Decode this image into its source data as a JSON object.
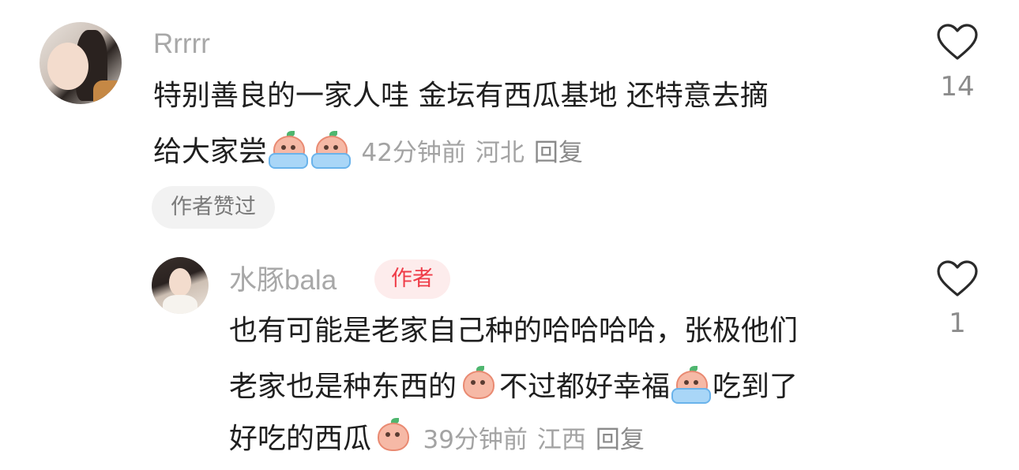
{
  "comment": {
    "username": "Rrrrr",
    "text_line1": "特别善良的一家人哇 金坛有西瓜基地 还特意去摘",
    "text_line2": "给大家尝",
    "time": "42分钟前",
    "location": "河北",
    "reply_label": "回复",
    "praise_badge": "作者赞过",
    "like_count": "14"
  },
  "reply": {
    "username": "水豚bala",
    "author_badge": "作者",
    "text_line1": "也有可能是老家自己种的哈哈哈哈，张极他们",
    "text_line2a": "老家也是种东西的",
    "text_line2b": "不过都好幸福",
    "text_line2c": "吃到了",
    "text_line3": "好吃的西瓜",
    "time": "39分钟前",
    "location": "江西",
    "reply_label": "回复",
    "like_count": "1"
  },
  "icons": {
    "heart": "heart-outline-icon",
    "emoji": "peach-crying-emoji-icon"
  },
  "colors": {
    "author_badge_text": "#ef3c48",
    "author_badge_bg": "#fdecec",
    "meta_text": "#a3a3a3"
  }
}
